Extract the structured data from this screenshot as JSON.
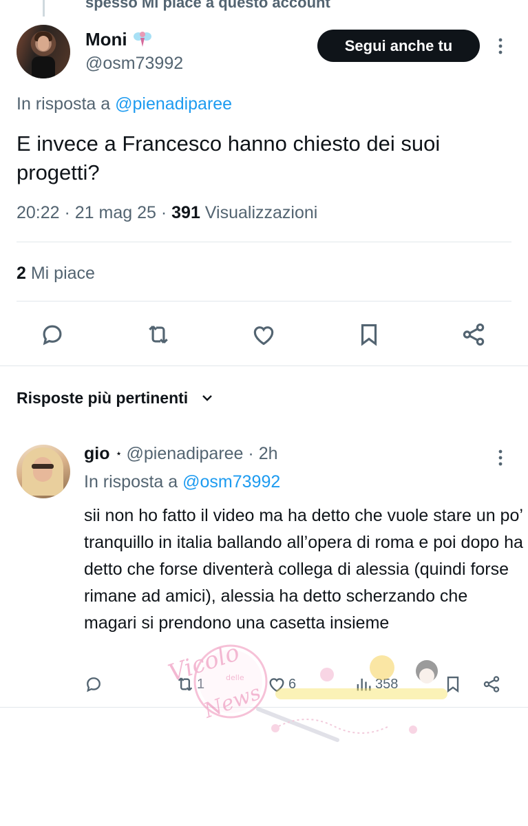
{
  "context_label": "spesso Mi piace a questo account",
  "tweet": {
    "author_name": "Moni",
    "author_handle": "@osm73992",
    "follow_button": "Segui anche tu",
    "reply_prefix": "In risposta a",
    "reply_mention": "@pienadiparee",
    "text": "E invece a Francesco hanno chiesto dei suoi progetti?",
    "time": "20:22 · 21 mag 25 · ",
    "views_count": "391",
    "views_label": " Visualizzazioni",
    "likes_count": "2",
    "likes_label": " Mi piace"
  },
  "section_title": "Risposte più pertinenti",
  "reply": {
    "author_name": "gio",
    "author_star": "⋆",
    "author_handle": "@pienadiparee",
    "time_sep": " · ",
    "time": "2h",
    "reply_prefix": "In risposta a",
    "reply_mention": "@osm73992",
    "text": "sii non ho fatto il video ma ha detto che vuole stare un po’ tranquillo in italia ballando all’opera di roma e poi dopo ha detto che forse diventerà collega di alessia (quindi forse rimane ad amici), alessia ha detto scherzando che magari si prendono una casetta insieme",
    "retweets": "1",
    "likes": "6",
    "views": "358"
  },
  "watermark": {
    "line1": "Vicolo",
    "line2": "delle",
    "line3": "News"
  },
  "colors": {
    "text": "#0f1419",
    "secondary": "#536471",
    "link": "#1d9bf0",
    "button_bg": "#0f1419",
    "divider": "#e1e7eb"
  }
}
